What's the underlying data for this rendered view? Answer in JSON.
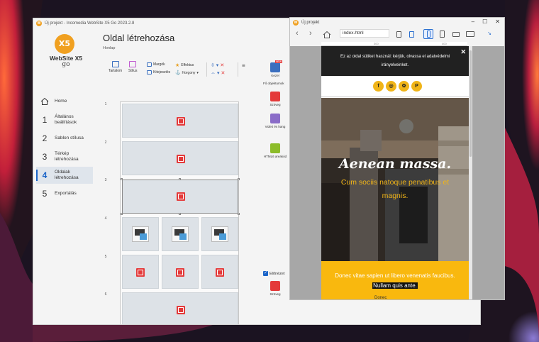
{
  "main_window": {
    "title": "Új projekt - Incomedia WebSite X5 Go 2023.2.8",
    "page_title": "Oldal létrehozása",
    "breadcrumb": "Honlap"
  },
  "sidebar": {
    "logo_mark": "X5",
    "logo_text": "WebSite X5",
    "logo_sub": "go",
    "home_label": "Home",
    "items": [
      {
        "num": "1",
        "label": "Általános beállítások"
      },
      {
        "num": "2",
        "label": "Sablon stílusa"
      },
      {
        "num": "3",
        "label": "Térkép létrehozása"
      },
      {
        "num": "4",
        "label": "Oldalak létrehozása"
      },
      {
        "num": "5",
        "label": "Exportálás"
      }
    ]
  },
  "toolbar": {
    "tartalom": "Tartalom",
    "stilus": "Stílus",
    "margok": "Margók",
    "kitejesztes": "Kitejesztés",
    "effektus": "Effektus",
    "horgony": "Horgony"
  },
  "objects": {
    "kezel": "Kezel",
    "new_badge": "NEW",
    "header": "Fő objektumok",
    "szoveg": "Szöveg",
    "video": "Videó és hang",
    "html": "HTML6 areakód",
    "elonezet": "Előnézet",
    "szoveg2": "Szöveg"
  },
  "grid_rows": [
    "1",
    "2",
    "3",
    "4",
    "5",
    "6"
  ],
  "preview_window": {
    "title": "Új projekt",
    "url": "index.html",
    "ruler_marks": [
      "300",
      "400"
    ],
    "cookie_text": "Ez az oldal sütiket használ: kérjük, olvassa el adatvédelmi irányelveinket.",
    "social": [
      "f",
      "◎",
      "✿",
      "P"
    ],
    "hero_title": "Aenean massa.",
    "hero_sub": "Cum sociis natoque penatibus et magnis.",
    "band_text": "Donec vitae sapien ut libero venenatis faucibus.",
    "band_highlight": "Nullam quis ante.",
    "below_label": "Donec"
  },
  "colors": {
    "accent": "#f9b80e",
    "selection": "#1a64c8",
    "text_icon": "#e43a3a"
  }
}
